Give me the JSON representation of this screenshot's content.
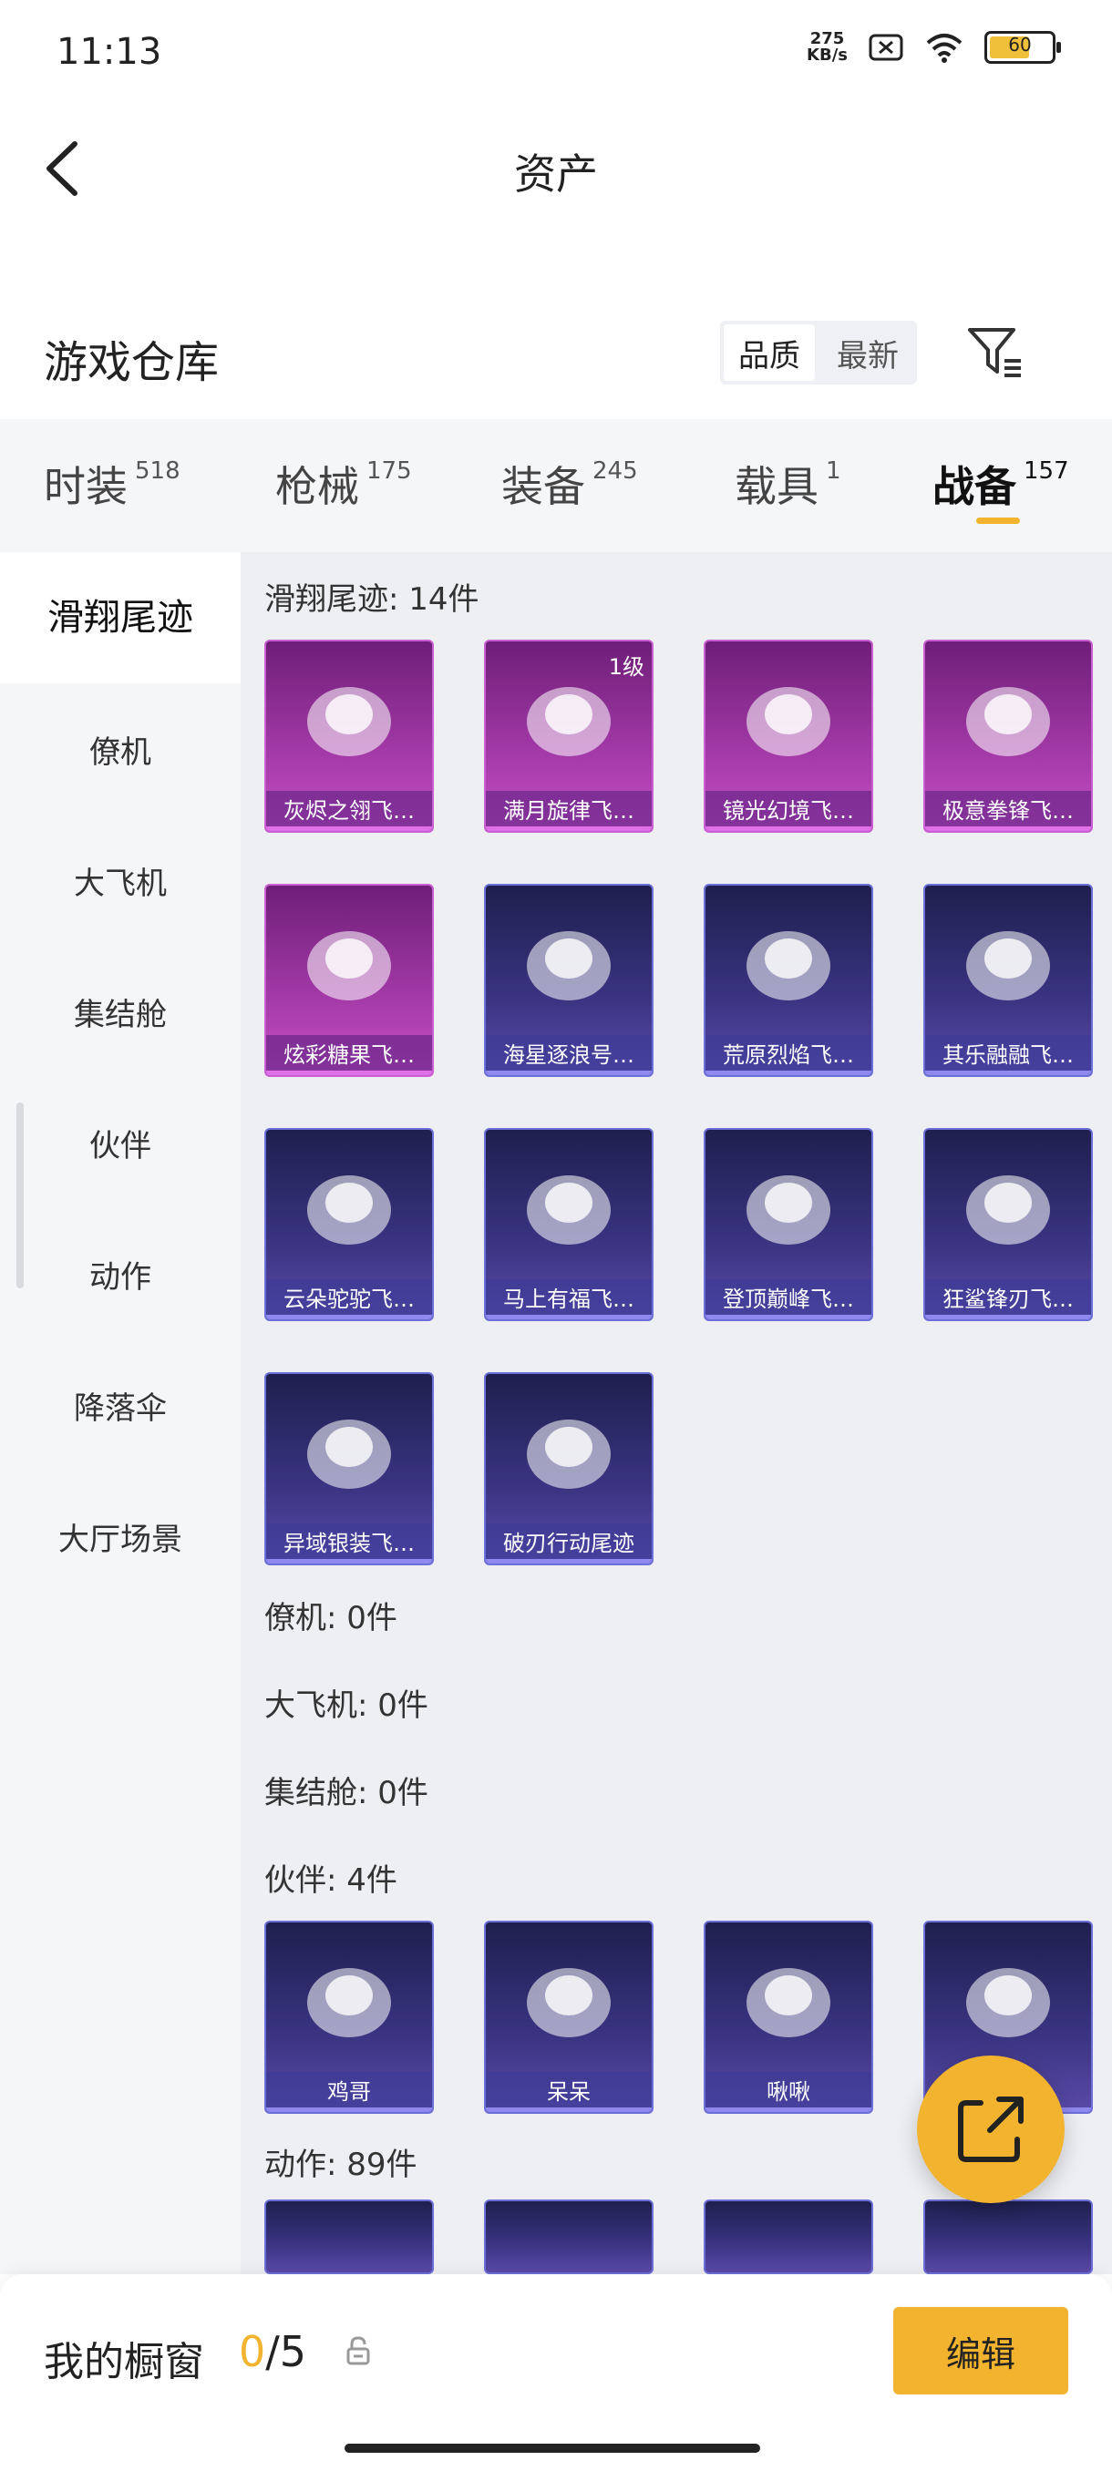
{
  "status": {
    "time": "11:13",
    "net_speed_top": "275",
    "net_speed_bottom": "KB/s",
    "battery": "60"
  },
  "header": {
    "title": "资产"
  },
  "warehouse": {
    "title": "游戏仓库",
    "sort_quality": "品质",
    "sort_latest": "最新"
  },
  "tabs": [
    {
      "label": "时装",
      "count": "518"
    },
    {
      "label": "枪械",
      "count": "175"
    },
    {
      "label": "装备",
      "count": "245"
    },
    {
      "label": "载具",
      "count": "1"
    },
    {
      "label": "战备",
      "count": "157"
    }
  ],
  "sidebar": [
    "滑翔尾迹",
    "僚机",
    "大飞机",
    "集结舱",
    "伙伴",
    "动作",
    "降落伞",
    "大厅场景"
  ],
  "sections": {
    "glide": "滑翔尾迹: 14件",
    "wingman": "僚机: 0件",
    "plane": "大飞机: 0件",
    "pod": "集结舱: 0件",
    "partner": "伙伴: 4件",
    "action": "动作: 89件"
  },
  "glide_items": [
    {
      "name": "灰烬之翎飞…",
      "rarity": "purple",
      "level": ""
    },
    {
      "name": "满月旋律飞…",
      "rarity": "purple",
      "level": "1级"
    },
    {
      "name": "镜光幻境飞…",
      "rarity": "purple",
      "level": ""
    },
    {
      "name": "极意拳锋飞…",
      "rarity": "purple",
      "level": ""
    },
    {
      "name": "炫彩糖果飞…",
      "rarity": "purple",
      "level": ""
    },
    {
      "name": "海星逐浪号…",
      "rarity": "blue",
      "level": ""
    },
    {
      "name": "荒原烈焰飞…",
      "rarity": "blue",
      "level": ""
    },
    {
      "name": "其乐融融飞…",
      "rarity": "blue",
      "level": ""
    },
    {
      "name": "云朵驼驼飞…",
      "rarity": "blue",
      "level": ""
    },
    {
      "name": "马上有福飞…",
      "rarity": "blue",
      "level": ""
    },
    {
      "name": "登顶巅峰飞…",
      "rarity": "blue",
      "level": ""
    },
    {
      "name": "狂鲨锋刃飞…",
      "rarity": "blue",
      "level": ""
    },
    {
      "name": "异域银装飞…",
      "rarity": "blue",
      "level": ""
    },
    {
      "name": "破刃行动尾迹",
      "rarity": "blue",
      "level": ""
    }
  ],
  "partner_items": [
    {
      "name": "鸡哥",
      "rarity": "blue"
    },
    {
      "name": "呆呆",
      "rarity": "blue"
    },
    {
      "name": "啾啾",
      "rarity": "blue"
    },
    {
      "name": "",
      "rarity": "blue"
    }
  ],
  "showcase": {
    "label": "我的橱窗",
    "current": "0",
    "total": "/5",
    "edit": "编辑"
  },
  "colors": {
    "accent": "#f2b32e",
    "purple_card": "#a43aa8",
    "blue_card": "#3a3482"
  }
}
